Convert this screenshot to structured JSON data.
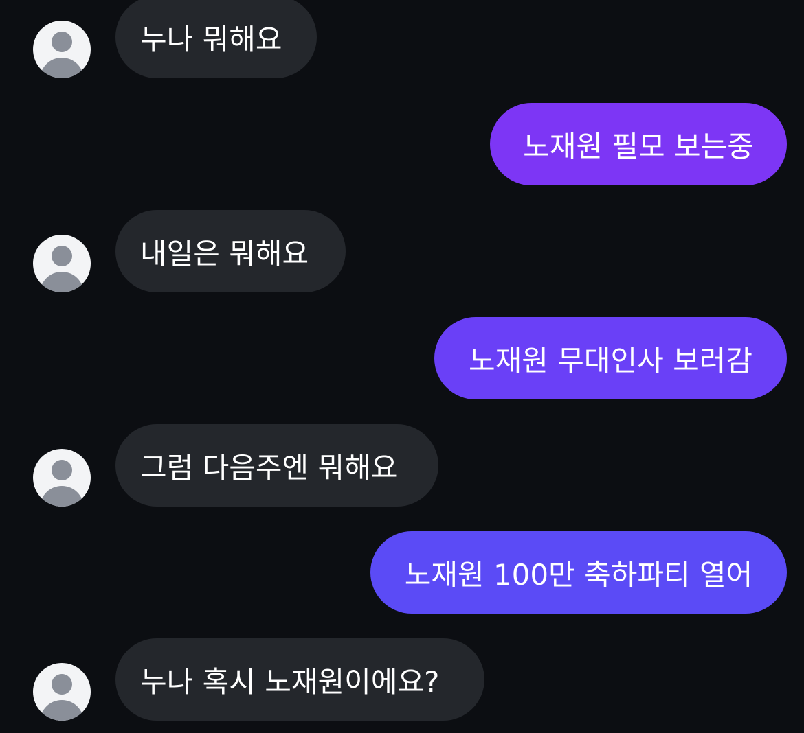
{
  "conversation": {
    "messages": [
      {
        "direction": "incoming",
        "text": "누나 뭐해요"
      },
      {
        "direction": "outgoing",
        "text": "노재원 필모 보는중"
      },
      {
        "direction": "incoming",
        "text": "내일은 뭐해요"
      },
      {
        "direction": "outgoing",
        "text": "노재원 무대인사 보러감"
      },
      {
        "direction": "incoming",
        "text": "그럼 다음주엔 뭐해요"
      },
      {
        "direction": "outgoing",
        "text": "노재원 100만 축하파티 열어"
      },
      {
        "direction": "incoming",
        "text": "누나 혹시 노재원이에요?"
      }
    ]
  },
  "colors": {
    "background": "#0c0e12",
    "incoming_bubble": "#24272c",
    "outgoing_bubble_1": "#7d36f5",
    "outgoing_bubble_2": "#6a40f7",
    "outgoing_bubble_3": "#5b4bf6",
    "avatar_bg": "#f3f4f6",
    "avatar_fg": "#8a8f99",
    "text": "#ffffff"
  },
  "icons": {
    "avatar": "default-user-avatar-icon"
  }
}
